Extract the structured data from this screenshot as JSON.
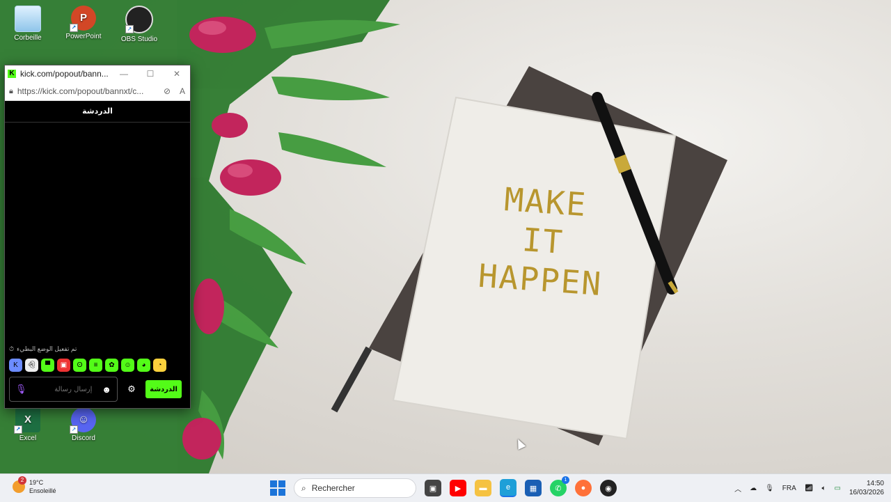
{
  "desktop": {
    "wallpaper_text": [
      "MAKE",
      "IT",
      "HAPPEN"
    ],
    "icons": [
      {
        "label": "Corbeille",
        "icon": "recycle-bin-icon"
      },
      {
        "label": "PowerPoint",
        "icon": "powerpoint-icon"
      },
      {
        "label": "OBS Studio",
        "icon": "obs-icon"
      },
      {
        "label": "Excel",
        "icon": "excel-icon"
      },
      {
        "label": "Discord",
        "icon": "discord-icon"
      }
    ]
  },
  "popup": {
    "title": "kick.com/popout/bann...",
    "url": "https://kick.com/popout/bannxt/c...",
    "header": "الدردشة",
    "status": "تم تفعيل الوضع البطيء",
    "emotes": [
      "kick-emote",
      "ghost-emote",
      "green-emote",
      "angry-emote",
      "frog-emote",
      "green-emote",
      "frog-emote",
      "smile-emote",
      "green-emote",
      "clown-emote"
    ],
    "input_placeholder": "إرسال رسالة",
    "send_label": "الدردشة",
    "accent": "#53fc18"
  },
  "taskbar": {
    "weather_temp": "19°C",
    "weather_desc": "Ensoleillé",
    "weather_badge": "2",
    "search_placeholder": "Rechercher",
    "whatsapp_badge": "1",
    "language": "FRA",
    "time": "14:50",
    "date": "16/03/2026"
  }
}
